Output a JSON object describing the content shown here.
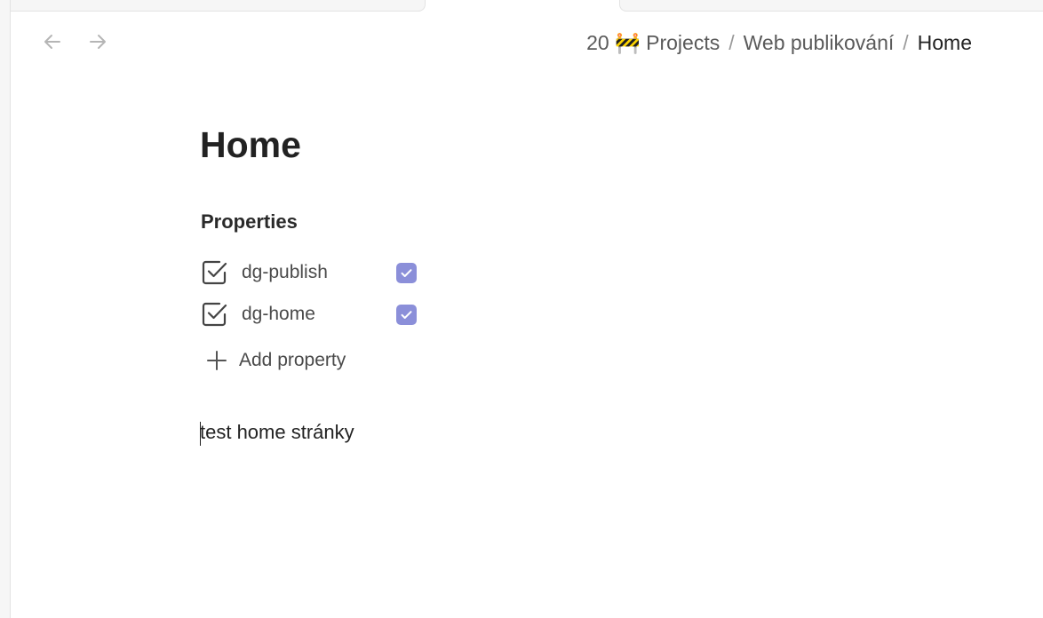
{
  "breadcrumb": {
    "items": [
      {
        "label": "20 🚧 Projects"
      },
      {
        "label": "Web publikování"
      },
      {
        "label": "Home"
      }
    ],
    "separator": "/"
  },
  "page": {
    "title": "Home",
    "properties_heading": "Properties",
    "properties": [
      {
        "name": "dg-publish",
        "type_icon": "checkbox-type-icon",
        "checked": true
      },
      {
        "name": "dg-home",
        "type_icon": "checkbox-type-icon",
        "checked": true
      }
    ],
    "add_property_label": "Add property",
    "body_text": "test home stránky"
  },
  "colors": {
    "checkbox_accent": "#8b8fd9",
    "text": "#222222",
    "muted_text": "#5a5a5a"
  }
}
